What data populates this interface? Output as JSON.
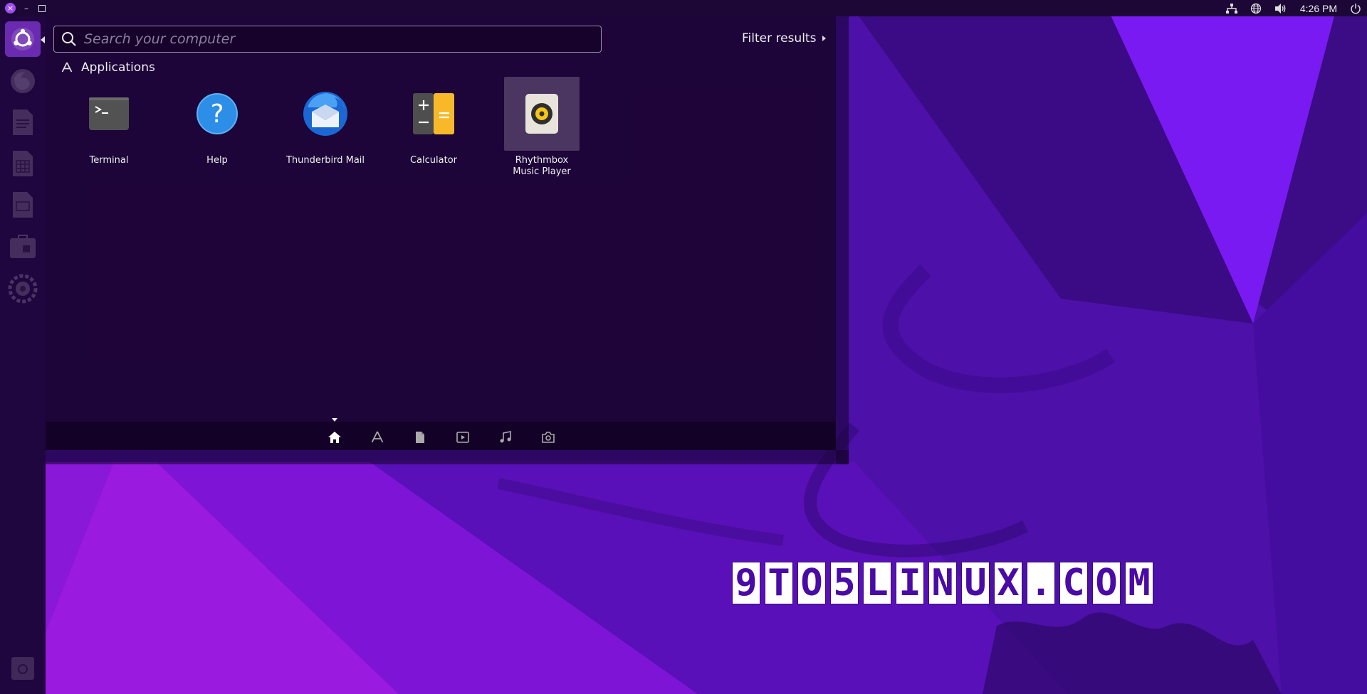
{
  "window_controls": {
    "close_symbol": "×",
    "minimize_symbol": "–"
  },
  "panel": {
    "clock": "4:26 PM",
    "tray": [
      "network-icon",
      "globe-icon",
      "volume-icon",
      "power-icon"
    ]
  },
  "launcher": {
    "items": [
      "ubuntu-logo-icon",
      "firefox-icon",
      "writer-icon",
      "calc-icon",
      "impress-icon",
      "software-icon",
      "settings-icon",
      "trash-icon"
    ]
  },
  "dash": {
    "search_placeholder": "Search your computer",
    "filter_label": "Filter results",
    "category": "Applications",
    "apps": [
      {
        "label": "Terminal",
        "icon": "terminal-icon"
      },
      {
        "label": "Help",
        "icon": "help-icon"
      },
      {
        "label": "Thunderbird Mail",
        "icon": "thunderbird-icon"
      },
      {
        "label": "Calculator",
        "icon": "calculator-icon"
      },
      {
        "label": "Rhythmbox Music Player",
        "icon": "rhythmbox-icon",
        "selected": true
      }
    ],
    "lenses": [
      "home-icon",
      "applications-icon",
      "files-icon",
      "video-icon",
      "music-icon",
      "photos-icon"
    ],
    "active_lens": "home-icon"
  },
  "watermark": [
    "9",
    "T",
    "O",
    "5",
    "L",
    "I",
    "N",
    "U",
    "X",
    ".",
    "C",
    "O",
    "M"
  ],
  "colors": {
    "panel": "#1c0736",
    "dash": "#1a0330",
    "accent": "#6b2bb0",
    "watermark_text": "#4a0aa6"
  }
}
